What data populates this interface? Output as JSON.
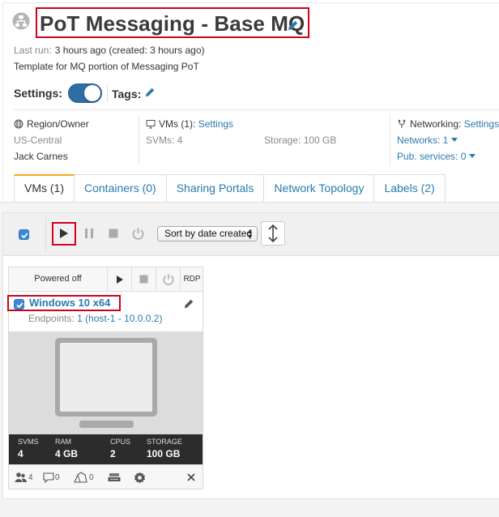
{
  "header": {
    "title": "PoT Messaging - Base MQ",
    "last_run_label": "Last run:",
    "last_run_value": "3 hours ago (created: 3 hours ago)",
    "description": "Template for MQ portion of Messaging PoT"
  },
  "settings": {
    "label": "Settings:",
    "enabled": true,
    "tags_label": "Tags:"
  },
  "info": {
    "region": {
      "label": "Region/Owner",
      "value": "US-Central",
      "owner": "Jack Carnes"
    },
    "vms": {
      "label": "VMs (1):",
      "link": "Settings",
      "svms": "SVMs: 4",
      "storage": "Storage: 100 GB"
    },
    "networking": {
      "label": "Networking:",
      "link": "Settings",
      "networks": "Networks: 1",
      "pub_services": "Pub. services: 0"
    }
  },
  "tabs": [
    {
      "label": "VMs (1)",
      "active": true
    },
    {
      "label": "Containers (0)",
      "active": false
    },
    {
      "label": "Sharing Portals",
      "active": false
    },
    {
      "label": "Network Topology",
      "active": false
    },
    {
      "label": "Labels (2)",
      "active": false
    }
  ],
  "toolbar": {
    "sort_label": "Sort by date created"
  },
  "vm_card": {
    "status": "Powered off",
    "rdp_label": "RDP",
    "name": "Windows 10 x64",
    "endpoints_label": "Endpoints:",
    "endpoints_value": "1 (host-1 - 10.0.0.2)",
    "stats": [
      {
        "key": "SVMS",
        "value": "4"
      },
      {
        "key": "RAM",
        "value": "4 GB"
      },
      {
        "key": "CPUS",
        "value": "2"
      },
      {
        "key": "STORAGE",
        "value": "100 GB"
      }
    ],
    "footer": {
      "users": "4",
      "comments": "0",
      "snapshots": "0"
    }
  },
  "colors": {
    "accent": "#2a7ab0",
    "highlight": "#d0021b",
    "tab_active": "#f5a623",
    "toggle_on": "#2f6ea5"
  }
}
